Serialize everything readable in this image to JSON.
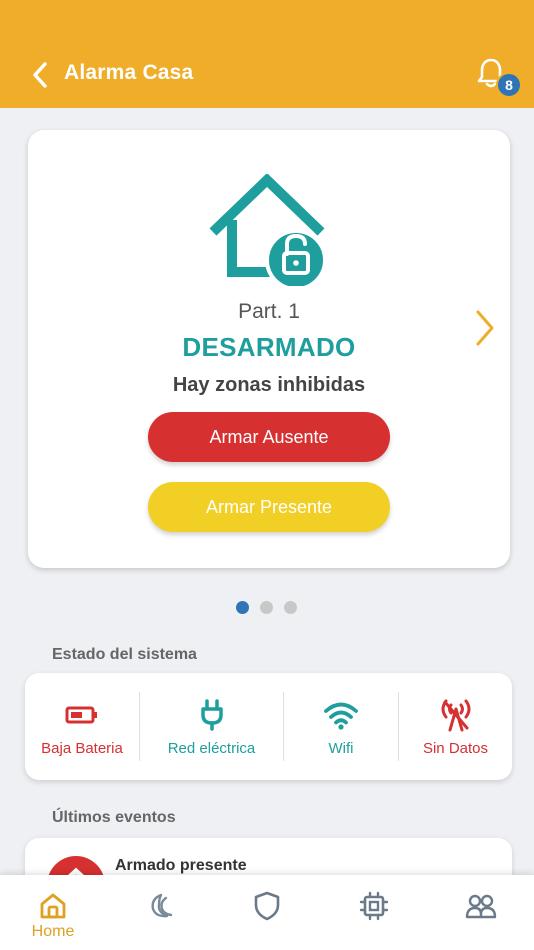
{
  "header": {
    "title": "Alarma Casa",
    "notification_count": "8",
    "bg_color": "#efad2a"
  },
  "partition_card": {
    "partition_label": "Part. 1",
    "state": "DESARMADO",
    "message": "Hay zonas inhibidas",
    "arm_away_label": "Armar Ausente",
    "arm_home_label": "Armar Presente",
    "house_icon": "house-unlocked-icon",
    "state_color": "#1f9e9e"
  },
  "pager": {
    "total": 3,
    "active": 1
  },
  "system_status": {
    "title": "Estado del sistema",
    "items": [
      {
        "icon": "battery-low-icon",
        "label": "Baja Bateria",
        "color": "#d63031"
      },
      {
        "icon": "plug-icon",
        "label": "Red eléctrica",
        "color": "#1f9e9e"
      },
      {
        "icon": "wifi-icon",
        "label": "Wifi",
        "color": "#1f9e9e"
      },
      {
        "icon": "no-signal-icon",
        "label": "Sin Datos",
        "color": "#d63031"
      }
    ]
  },
  "events": {
    "title": "Últimos eventos",
    "items": [
      {
        "title": "Armado presente",
        "icon": "armed-home-icon"
      }
    ]
  },
  "bottom_nav": {
    "items": [
      {
        "icon": "home-icon",
        "label": "Home",
        "active": true
      },
      {
        "icon": "moon-icon",
        "label": "",
        "active": false
      },
      {
        "icon": "shield-icon",
        "label": "",
        "active": false
      },
      {
        "icon": "chip-icon",
        "label": "",
        "active": false
      },
      {
        "icon": "users-icon",
        "label": "",
        "active": false
      }
    ]
  }
}
